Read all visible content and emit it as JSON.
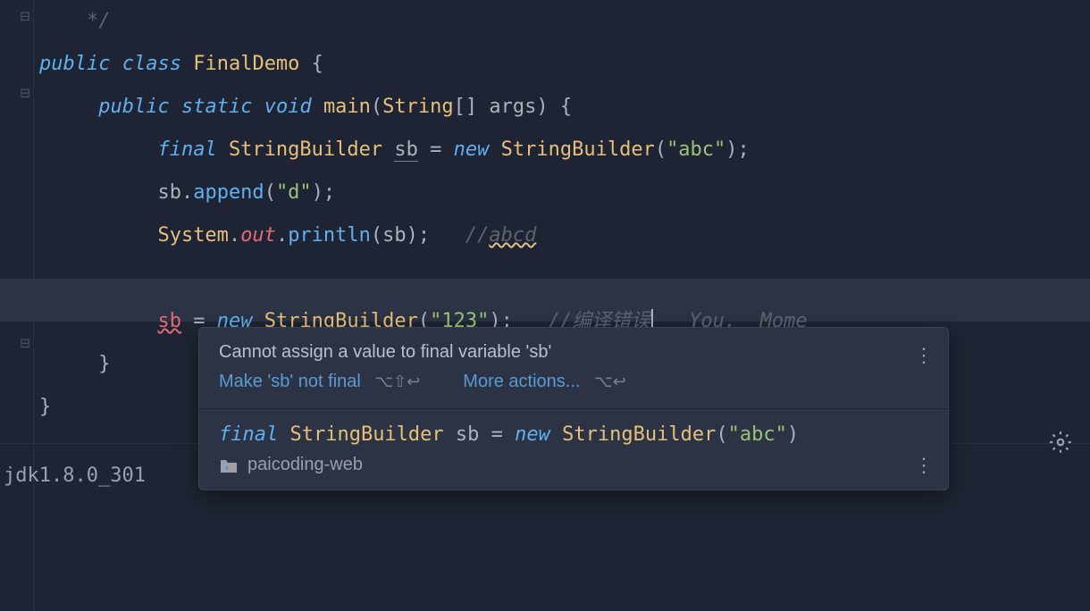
{
  "code": {
    "line0_comment_close": "*/",
    "line1": {
      "kw_public": "public",
      "kw_class": "class",
      "class_name": "FinalDemo",
      "brace": " {"
    },
    "line2": {
      "kw_public": "public",
      "kw_static": "static",
      "kw_void": "void",
      "method": "main",
      "paren_open": "(",
      "type": "String",
      "brackets": "[] ",
      "param": "args",
      "tail": ") {"
    },
    "line3": {
      "kw_final": "final",
      "type": "StringBuilder",
      "var": "sb",
      "eq": " = ",
      "kw_new": "new",
      "ctor": "StringBuilder",
      "po": "(",
      "str": "\"abc\"",
      "tail": ");"
    },
    "line4": {
      "var": "sb",
      "dot": ".",
      "method": "append",
      "po": "(",
      "str": "\"d\"",
      "tail": ");"
    },
    "line5": {
      "sys": "System",
      "dot1": ".",
      "out": "out",
      "dot2": ".",
      "method": "println",
      "po": "(",
      "arg": "sb",
      "tail": ");",
      "comment_prefix": "//",
      "comment_text": "abcd"
    },
    "line7": {
      "var": "sb",
      "eq": " = ",
      "kw_new": "new",
      "ctor": "StringBuilder",
      "po": "(",
      "str": "\"123\"",
      "tail": ");",
      "comment": "//编译错误",
      "hint": "You,  Mome"
    },
    "line8_brace": "}",
    "line9_brace": "}"
  },
  "tooltip": {
    "error_message": "Cannot assign a value to final variable 'sb'",
    "fix_label": "Make 'sb' not final",
    "fix_shortcut": "⌥⇧↩",
    "more_label": "More actions...",
    "more_shortcut": "⌥↩",
    "declaration": {
      "kw_final": "final",
      "type": "StringBuilder",
      "var": "sb",
      "eq": " = ",
      "kw_new": "new",
      "ctor": "StringBuilder",
      "po": "(",
      "str": "\"abc\"",
      "pc": ")"
    },
    "source_module": "paicoding-web"
  },
  "footer": {
    "jdk": "jdk1.8.0_301"
  }
}
